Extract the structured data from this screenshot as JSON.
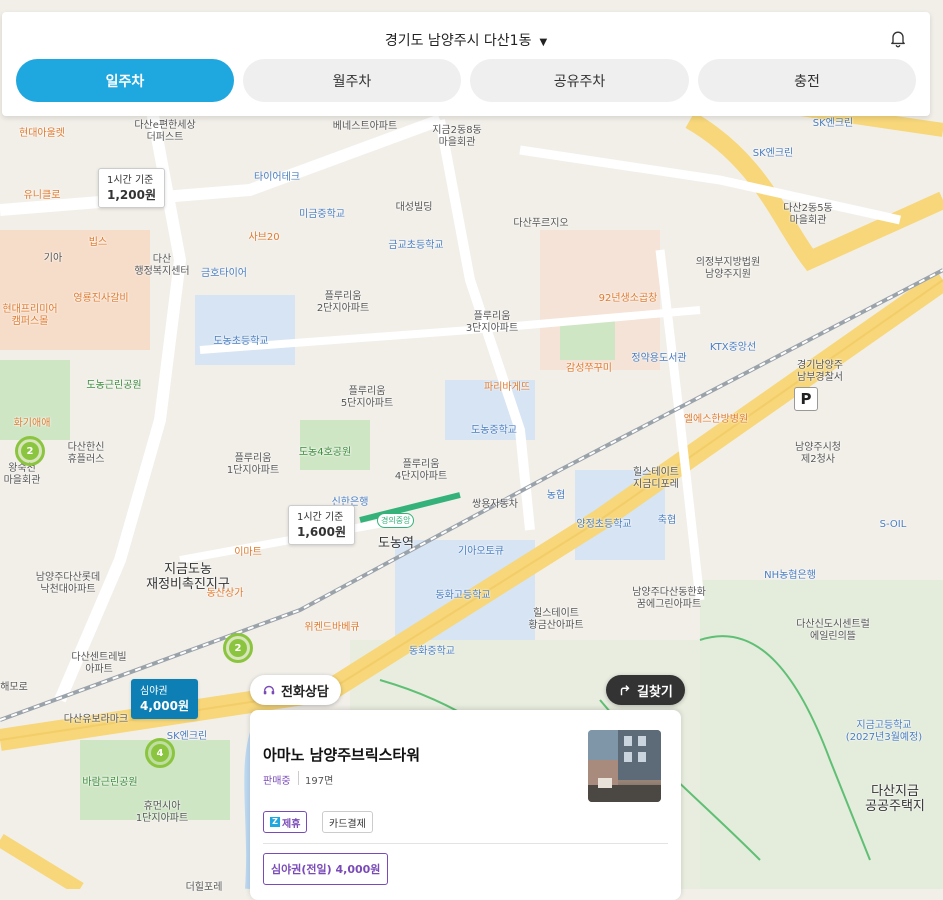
{
  "header": {
    "location": "경기도 남양주시 다산1동",
    "location_caret": "▼",
    "bell_icon": "bell-icon"
  },
  "tabs": [
    {
      "label": "일주차",
      "active": true
    },
    {
      "label": "월주차",
      "active": false
    },
    {
      "label": "공유주차",
      "active": false
    },
    {
      "label": "충전",
      "active": false
    }
  ],
  "map": {
    "labels": [
      {
        "text": "현대아울렛",
        "style": "orange"
      },
      {
        "text": "다산e편한세상\n더퍼스트",
        "style": ""
      },
      {
        "text": "베네스트아파트",
        "style": ""
      },
      {
        "text": "지금2동8동\n마을회관",
        "style": ""
      },
      {
        "text": "SK엔크린",
        "style": "blue"
      },
      {
        "text": "SK엔크린",
        "style": "blue"
      },
      {
        "text": "유니클로",
        "style": "orange"
      },
      {
        "text": "타이어테크",
        "style": "blue"
      },
      {
        "text": "미금중학교",
        "style": "blue"
      },
      {
        "text": "대성빌딩",
        "style": ""
      },
      {
        "text": "다산푸르지오",
        "style": ""
      },
      {
        "text": "다산2동5동\n마을회관",
        "style": ""
      },
      {
        "text": "빕스",
        "style": "orange"
      },
      {
        "text": "사브20",
        "style": "orange"
      },
      {
        "text": "금교초등학교",
        "style": "blue"
      },
      {
        "text": "기아",
        "style": ""
      },
      {
        "text": "다산\n행정복지센터",
        "style": ""
      },
      {
        "text": "금호타이어",
        "style": "blue"
      },
      {
        "text": "의정부지방법원\n남양주지원",
        "style": ""
      },
      {
        "text": "영룡진사갈비",
        "style": "orange"
      },
      {
        "text": "플루리움\n2단지아파트",
        "style": ""
      },
      {
        "text": "플루리움\n3단지아파트",
        "style": ""
      },
      {
        "text": "92년생소곱창",
        "style": "orange"
      },
      {
        "text": "현대프리미어\n캠퍼스몰",
        "style": "orange"
      },
      {
        "text": "도농초등학교",
        "style": "blue"
      },
      {
        "text": "감성쭈꾸미",
        "style": "orange"
      },
      {
        "text": "정약용도서관",
        "style": "blue"
      },
      {
        "text": "KTX중앙선",
        "style": "blue"
      },
      {
        "text": "경기남양주\n남부경찰서",
        "style": ""
      },
      {
        "text": "도농근린공원",
        "style": "green"
      },
      {
        "text": "플루리움\n5단지아파트",
        "style": ""
      },
      {
        "text": "파리바게뜨",
        "style": "orange"
      },
      {
        "text": "화기애애",
        "style": "orange"
      },
      {
        "text": "엘에스한방병원",
        "style": "orange"
      },
      {
        "text": "도농중학교",
        "style": "blue"
      },
      {
        "text": "다산한신\n휴플러스",
        "style": ""
      },
      {
        "text": "왕숙천\n마을회관",
        "style": ""
      },
      {
        "text": "플루리움\n1단지아파트",
        "style": ""
      },
      {
        "text": "도농4호공원",
        "style": "green"
      },
      {
        "text": "남양주시청\n제2청사",
        "style": ""
      },
      {
        "text": "플루리움\n4단지아파트",
        "style": ""
      },
      {
        "text": "힐스테이트\n지금디포레",
        "style": ""
      },
      {
        "text": "신한은행",
        "style": "blue"
      },
      {
        "text": "쌍용자동차",
        "style": ""
      },
      {
        "text": "농협",
        "style": "blue"
      },
      {
        "text": "축협",
        "style": "blue"
      },
      {
        "text": "S-OIL",
        "style": "blue"
      },
      {
        "text": "양정초등학교",
        "style": "blue"
      },
      {
        "text": "도농역",
        "style": "big"
      },
      {
        "text": "기아오토큐",
        "style": "blue"
      },
      {
        "text": "이마트",
        "style": "orange"
      },
      {
        "text": "지금도농\n재정비촉진지구",
        "style": "big"
      },
      {
        "text": "남양주다산롯데\n낙천대아파트",
        "style": ""
      },
      {
        "text": "NH농협은행",
        "style": "blue"
      },
      {
        "text": "동산상가",
        "style": "orange"
      },
      {
        "text": "남양주다산동한화\n꿈에그린아파트",
        "style": ""
      },
      {
        "text": "동화고등학교",
        "style": "blue"
      },
      {
        "text": "다산신도시센트럴\n에일린의뜰",
        "style": ""
      },
      {
        "text": "위켄드바베큐",
        "style": "orange"
      },
      {
        "text": "힐스테이트\n황금산아파트",
        "style": ""
      },
      {
        "text": "다산센트레빌\n아파트",
        "style": ""
      },
      {
        "text": "동화중학교",
        "style": "blue"
      },
      {
        "text": "해모로",
        "style": ""
      },
      {
        "text": "다산유보라마크",
        "style": ""
      },
      {
        "text": "지금고등학교\n(2027년3월예정)",
        "style": "blue"
      },
      {
        "text": "SK엔크린",
        "style": "blue"
      },
      {
        "text": "바람근린공원",
        "style": "green"
      },
      {
        "text": "다산지금\n공공주택지",
        "style": "big"
      },
      {
        "text": "휴먼시아\n1단지아파트",
        "style": ""
      },
      {
        "text": "더힐포레",
        "style": ""
      }
    ],
    "price_bubbles": [
      {
        "title": "1시간 기준",
        "price": "1,200원",
        "selected": false
      },
      {
        "title": "1시간 기준",
        "price": "1,600원",
        "selected": false
      },
      {
        "title": "심야권",
        "price": "4,000원",
        "selected": true
      }
    ],
    "clusters": [
      {
        "count": "2"
      },
      {
        "count": "2"
      },
      {
        "count": "4"
      }
    ],
    "parking_marker": "P",
    "station_badge": "경의중앙"
  },
  "actions": {
    "call_label": "전화상담",
    "route_label": "길찾기"
  },
  "card": {
    "name": "아마노 남양주브릭스타워",
    "status": "판매중",
    "spaces": "197면",
    "tags": [
      "제휴",
      "카드결제"
    ],
    "ticket": "심야권(전일) 4,000원"
  },
  "colors": {
    "accent": "#1fa7e0",
    "selected_marker": "#0e7fb5",
    "cluster": "#8bc53f",
    "partner": "#7a4bb8"
  }
}
